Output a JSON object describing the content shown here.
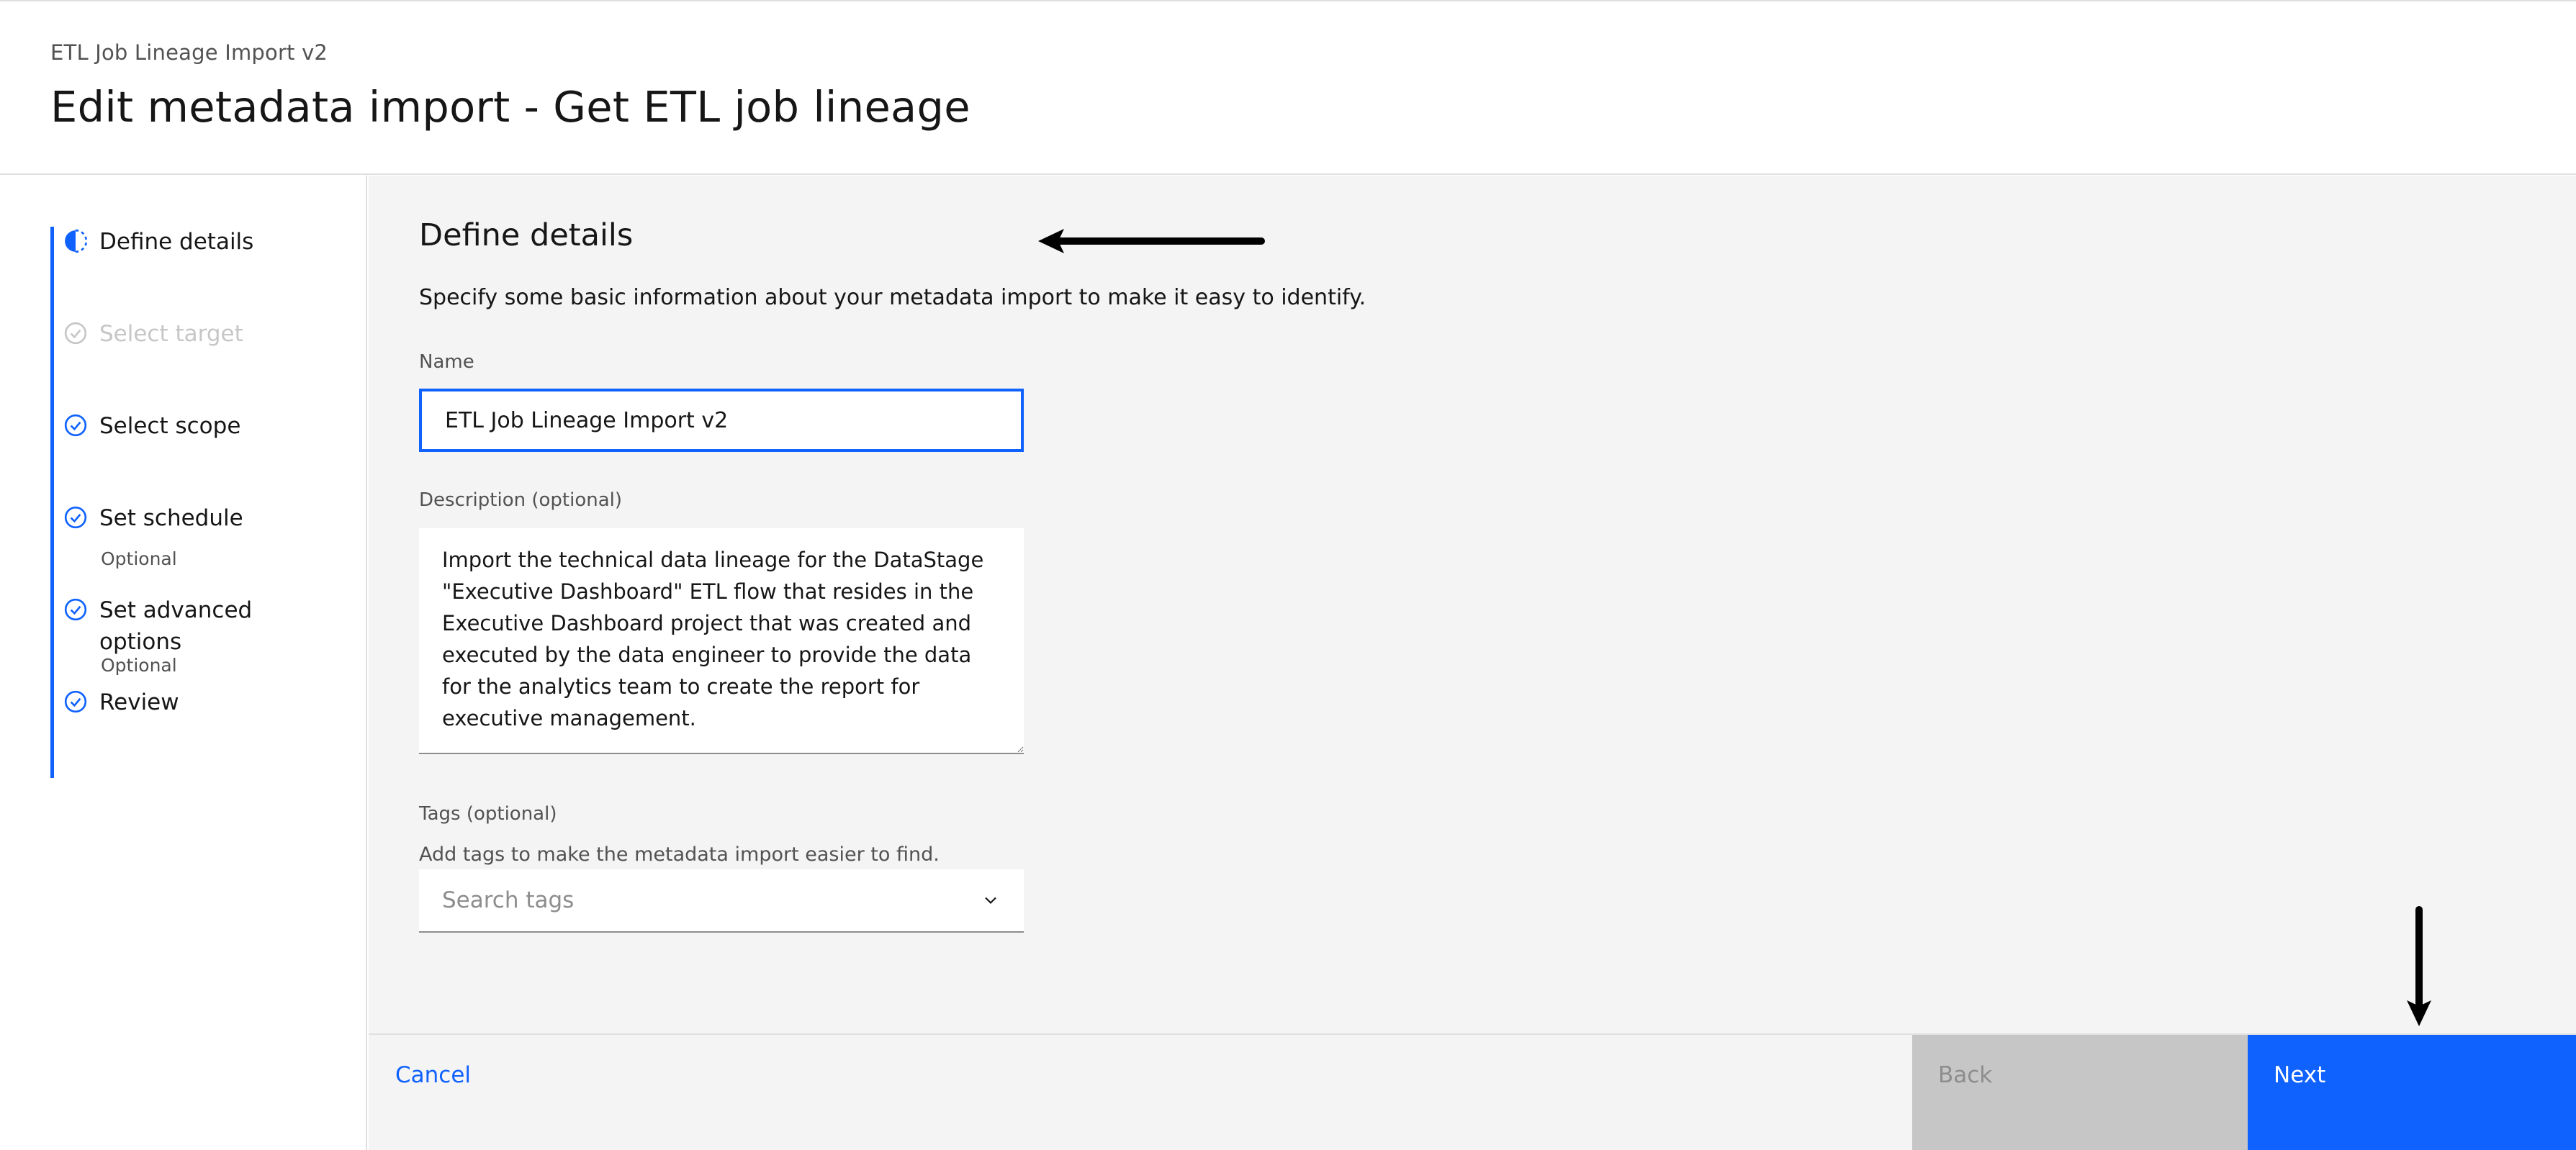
{
  "header": {
    "breadcrumb": "ETL Job Lineage Import v2",
    "title": "Edit metadata import - Get ETL job lineage"
  },
  "progress": {
    "steps": [
      {
        "label": "Define details",
        "state": "current",
        "icon": "half-circle-current-icon"
      },
      {
        "label": "Select target",
        "state": "disabled",
        "icon": "check-circle-icon"
      },
      {
        "label": "Select scope",
        "state": "complete",
        "icon": "check-circle-icon"
      },
      {
        "label": "Set schedule",
        "state": "complete",
        "icon": "check-circle-icon",
        "optional": "Optional"
      },
      {
        "label": "Set advanced\noptions",
        "state": "complete",
        "icon": "check-circle-icon",
        "optional": "Optional"
      },
      {
        "label": "Review",
        "state": "complete",
        "icon": "check-circle-icon"
      }
    ]
  },
  "form": {
    "section_title": "Define details",
    "section_description": "Specify some basic information about your metadata import to make it easy to identify.",
    "name_label": "Name",
    "name_value": "ETL Job Lineage Import v2",
    "description_label": "Description (optional)",
    "description_value": "Import the technical data lineage for the DataStage \"Executive Dashboard\" ETL flow that resides in the Executive Dashboard project that was created and executed by the data engineer to provide the data for the analytics team to create the report for executive management.",
    "tags_label": "Tags (optional)",
    "tags_helper": "Add tags to make the metadata import easier to find.",
    "tags_placeholder": "Search tags"
  },
  "footer": {
    "cancel": "Cancel",
    "back": "Back",
    "next": "Next"
  },
  "colors": {
    "accent": "#0f62fe",
    "disabled_bg": "#c6c6c6",
    "panel_bg": "#f4f4f4"
  }
}
